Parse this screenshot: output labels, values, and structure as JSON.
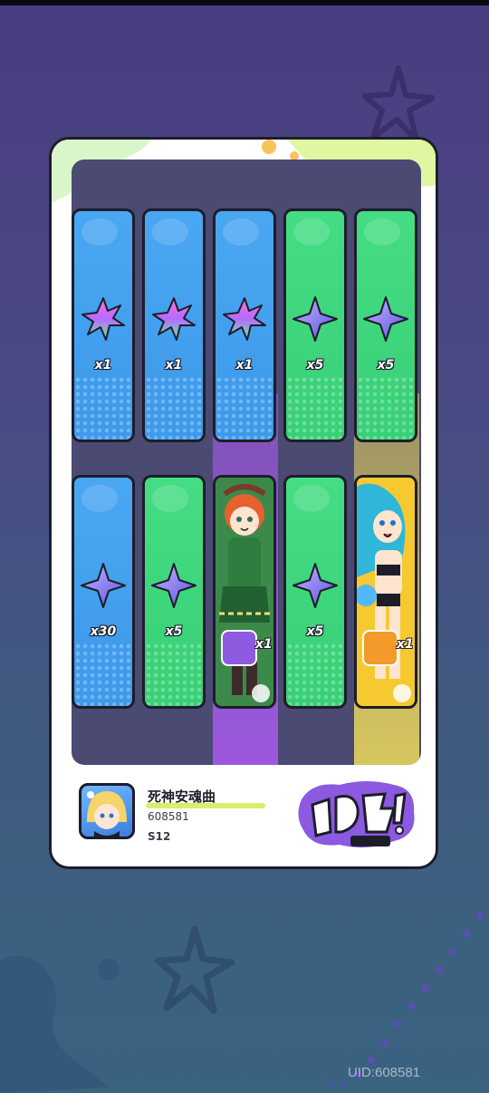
{
  "colors": {
    "blue_tile": "#49a7f2",
    "green_tile": "#45dd84",
    "purple_glow": "#aa5af0",
    "yellow_glow": "#fae65a",
    "card_border": "#1d1d2a"
  },
  "rewards": {
    "row1": [
      {
        "icon": "rainbow-crystal-icon",
        "tile": "blue",
        "count": "x1"
      },
      {
        "icon": "rainbow-crystal-icon",
        "tile": "blue",
        "count": "x1"
      },
      {
        "icon": "rainbow-crystal-icon",
        "tile": "blue",
        "count": "x1"
      },
      {
        "icon": "purple-star-gem-icon",
        "tile": "green",
        "count": "x5"
      },
      {
        "icon": "purple-star-gem-icon",
        "tile": "green",
        "count": "x5"
      }
    ],
    "row2": [
      {
        "icon": "purple-star-gem-icon",
        "tile": "blue",
        "count": "x30"
      },
      {
        "icon": "purple-star-gem-icon",
        "tile": "green",
        "count": "x5"
      },
      {
        "icon": "character-card-redhead-girl",
        "tile": "purple",
        "count": "x1"
      },
      {
        "icon": "purple-star-gem-icon",
        "tile": "green",
        "count": "x5"
      },
      {
        "icon": "character-card-bluehair-girl",
        "tile": "yellow",
        "count": "x1"
      }
    ]
  },
  "player": {
    "name": "死神安魂曲",
    "id": "608581",
    "season": "S12"
  },
  "logo_text": "乱斗！彩世界",
  "footer_uid": "UID:608581"
}
